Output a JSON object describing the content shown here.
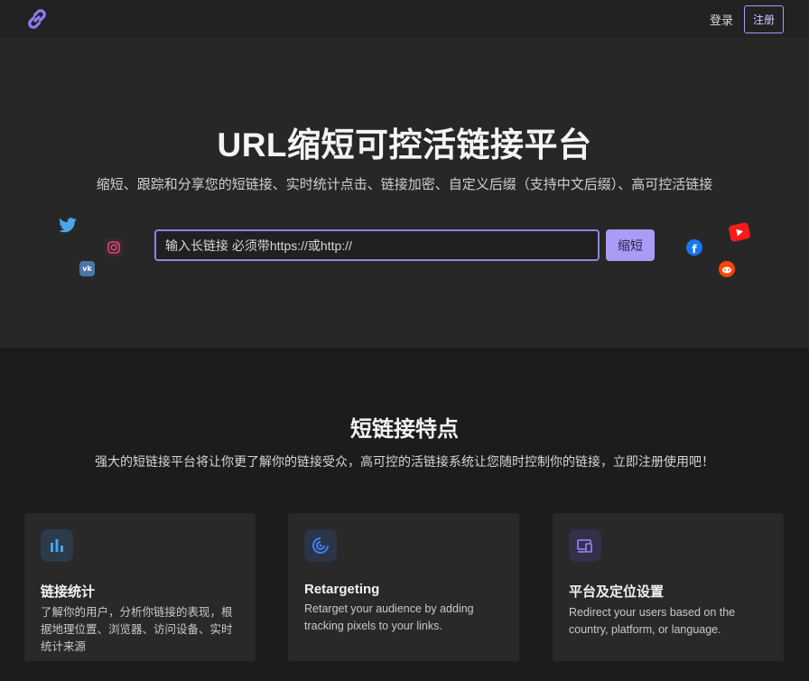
{
  "nav": {
    "logo_icon": "link-icon",
    "login_label": "登录",
    "register_label": "注册"
  },
  "hero": {
    "title": "URL缩短可控活链接平台",
    "subtitle": "缩短、跟踪和分享您的短链接、实时统计点击、链接加密、自定义后缀（支持中文后缀）、高可控活链接",
    "input_placeholder": "输入长链接 必须带https://或http://",
    "input_value": "",
    "shorten_label": "缩短",
    "social_icons": [
      "twitter-icon",
      "instagram-icon",
      "vk-icon",
      "facebook-icon",
      "youtube-icon",
      "reddit-icon"
    ]
  },
  "features": {
    "title": "短链接特点",
    "subtitle": "强大的短链接平台将让你更了解你的链接受众，高可控的活链接系统让您随时控制你的链接，立即注册使用吧！",
    "cards": [
      {
        "icon": "bar-chart-icon",
        "title": "链接统计",
        "desc": "了解你的用户，分析你链接的表现，根据地理位置、浏览器、访问设备、实时统计来源"
      },
      {
        "icon": "target-icon",
        "title": "Retargeting",
        "desc": "Retarget your audience by adding tracking pixels to your links."
      },
      {
        "icon": "devices-icon",
        "title": "平台及定位设置",
        "desc": "Redirect your users based on the country, platform, or language."
      }
    ]
  },
  "colors": {
    "accent": "#a99cf7",
    "nav_bg": "#222223",
    "hero_bg": "#272728",
    "page_bg": "#1c1c1d",
    "card_bg": "#29292a"
  }
}
